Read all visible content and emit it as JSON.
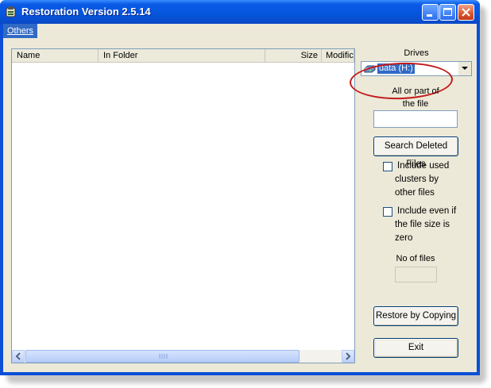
{
  "window": {
    "title": "Restoration Version 2.5.14"
  },
  "menu": {
    "items": [
      {
        "label": "Others",
        "underline_char": "O"
      }
    ]
  },
  "list": {
    "columns": [
      "Name",
      "In Folder",
      "Size",
      "Modific"
    ],
    "rows": []
  },
  "drives": {
    "label": "Drives",
    "selected": "data (H:)",
    "icon": "drive-icon"
  },
  "search": {
    "label_line1": "All or part of",
    "label_line2": "the file",
    "value": "",
    "button_label": "Search Deleted Files"
  },
  "options": [
    {
      "lines": [
        "Include used",
        "clusters by",
        "other files"
      ],
      "checked": false
    },
    {
      "lines": [
        "Include even if",
        "the file size is",
        "zero"
      ],
      "checked": false
    }
  ],
  "file_count": {
    "label": "No of files",
    "value": ""
  },
  "actions": {
    "restore_label": "Restore by Copying",
    "exit_label": "Exit"
  },
  "colors": {
    "title_bar": "#0555dd",
    "face": "#ece9d8",
    "highlight": "#316ac5",
    "annotation": "#c31b1b"
  }
}
